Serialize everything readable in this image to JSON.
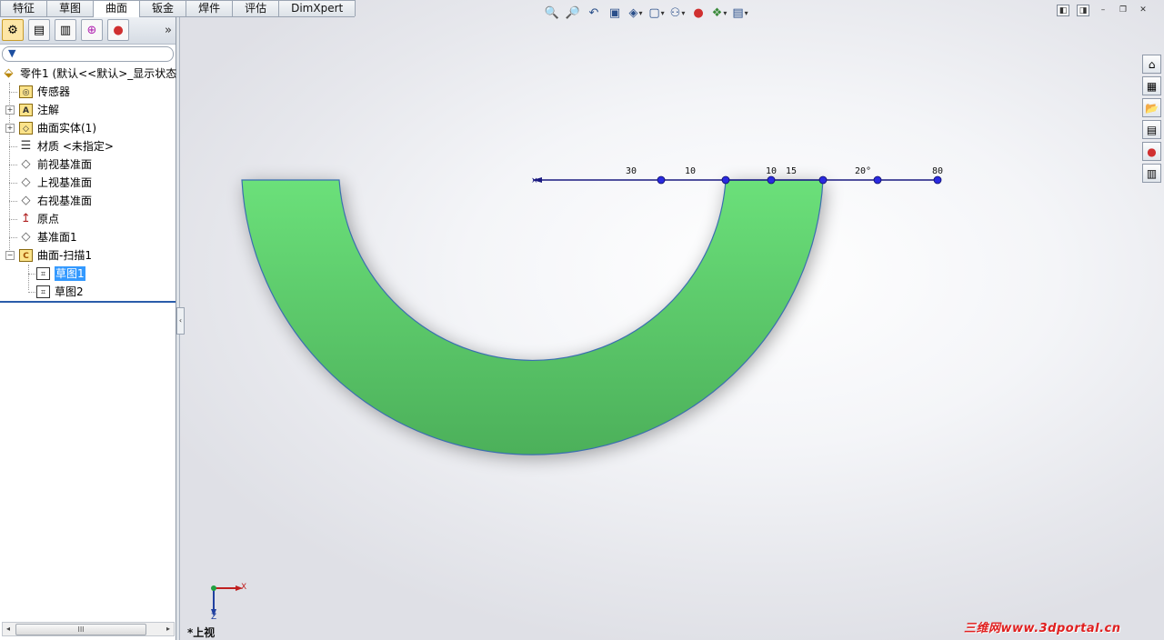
{
  "tabs": [
    "特征",
    "草图",
    "曲面",
    "钣金",
    "焊件",
    "评估",
    "DimXpert"
  ],
  "active_tab": "曲面",
  "sidebar": {
    "toolbar_icons": [
      "feature-manager-icon",
      "property-manager-icon",
      "configuration-manager-icon",
      "dimxpert-manager-icon",
      "display-manager-icon"
    ],
    "more_label": "»",
    "tree": {
      "root": "零件1 (默认<<默认>_显示状态",
      "sensors": "传感器",
      "annotations": "注解",
      "surface_bodies": "曲面实体(1)",
      "material": "材质 <未指定>",
      "front_plane": "前视基准面",
      "top_plane": "上视基准面",
      "right_plane": "右视基准面",
      "origin": "原点",
      "plane1": "基准面1",
      "sweep": "曲面-扫描1",
      "sketch1": "草图1",
      "sketch2": "草图2"
    },
    "scrollbar_grip": "III"
  },
  "viewport": {
    "view_name": "*上视",
    "triad": {
      "x": "X",
      "z": "Z"
    },
    "dimensions": [
      "30",
      "10",
      "10",
      "15",
      "20°",
      "80"
    ],
    "shape_color": "#5fd070",
    "edge_color": "#3a6fb0",
    "line_color": "#1a1a80"
  },
  "watermark": "三维网www.3dportal.cn"
}
